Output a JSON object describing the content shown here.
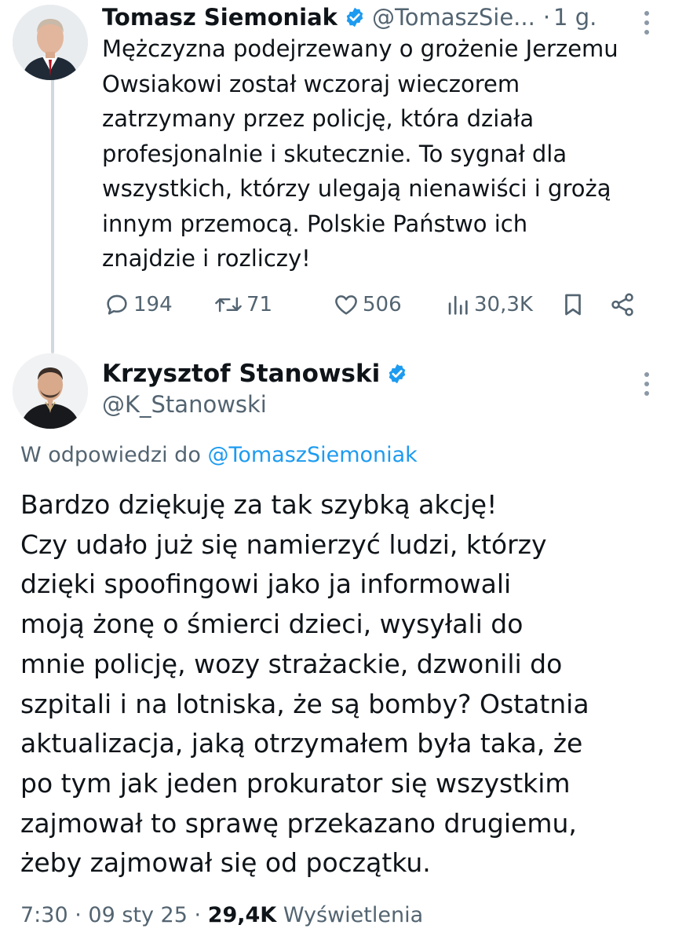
{
  "tweet1": {
    "author_name": "Tomasz Siemoniak",
    "handle": "@TomaszSie...",
    "time": "1 g.",
    "text": "Mężczyzna podejrzewany o grożenie Jerzemu\nOwsiakowi został wczoraj wieczorem\nzatrzymany przez policję, która działa\nprofesjonalnie i skutecznie. To sygnał dla\nwszystkich, którzy ulegają nienawiści i grożą\ninnym przemocą. Polskie Państwo ich\nznajdzie i rozliczy!",
    "stats": {
      "replies": "194",
      "reposts": "71",
      "likes": "506",
      "views": "30,3K"
    },
    "icons": {
      "reply": "reply-icon",
      "repost": "repost-icon",
      "like": "heart-icon",
      "views": "views-icon",
      "bookmark": "bookmark-icon",
      "share": "share-icon"
    }
  },
  "tweet2": {
    "author_name": "Krzysztof Stanowski",
    "handle": "@K_Stanowski",
    "reply_prefix": "W odpowiedzi do ",
    "reply_mention": "@TomaszSiemoniak",
    "text": "Bardzo dziękuję za tak szybką akcję!\nCzy udało już się namierzyć ludzi, którzy\ndzięki spoofingowi jako ja informowali\nmoją żonę o śmierci dzieci, wysyłali do\nmnie policję, wozy strażackie, dzwonili do\nszpitali i na lotniska, że są bomby? Ostatnia\naktualizacja, jaką otrzymałem była taka, że\npo tym jak jeden prokurator się wszystkim\nzajmował to sprawę przekazano drugiemu,\nżeby zajmował się od początku.",
    "time": "7:30",
    "date": "09 sty 25",
    "views_count": "29,4K",
    "views_label": "Wyświetlenia"
  },
  "colors": {
    "text": "#0f1419",
    "secondary": "#536471",
    "link": "#1d9bf0",
    "verified": "#1d9bf0",
    "thread_line": "#cfd9de"
  }
}
